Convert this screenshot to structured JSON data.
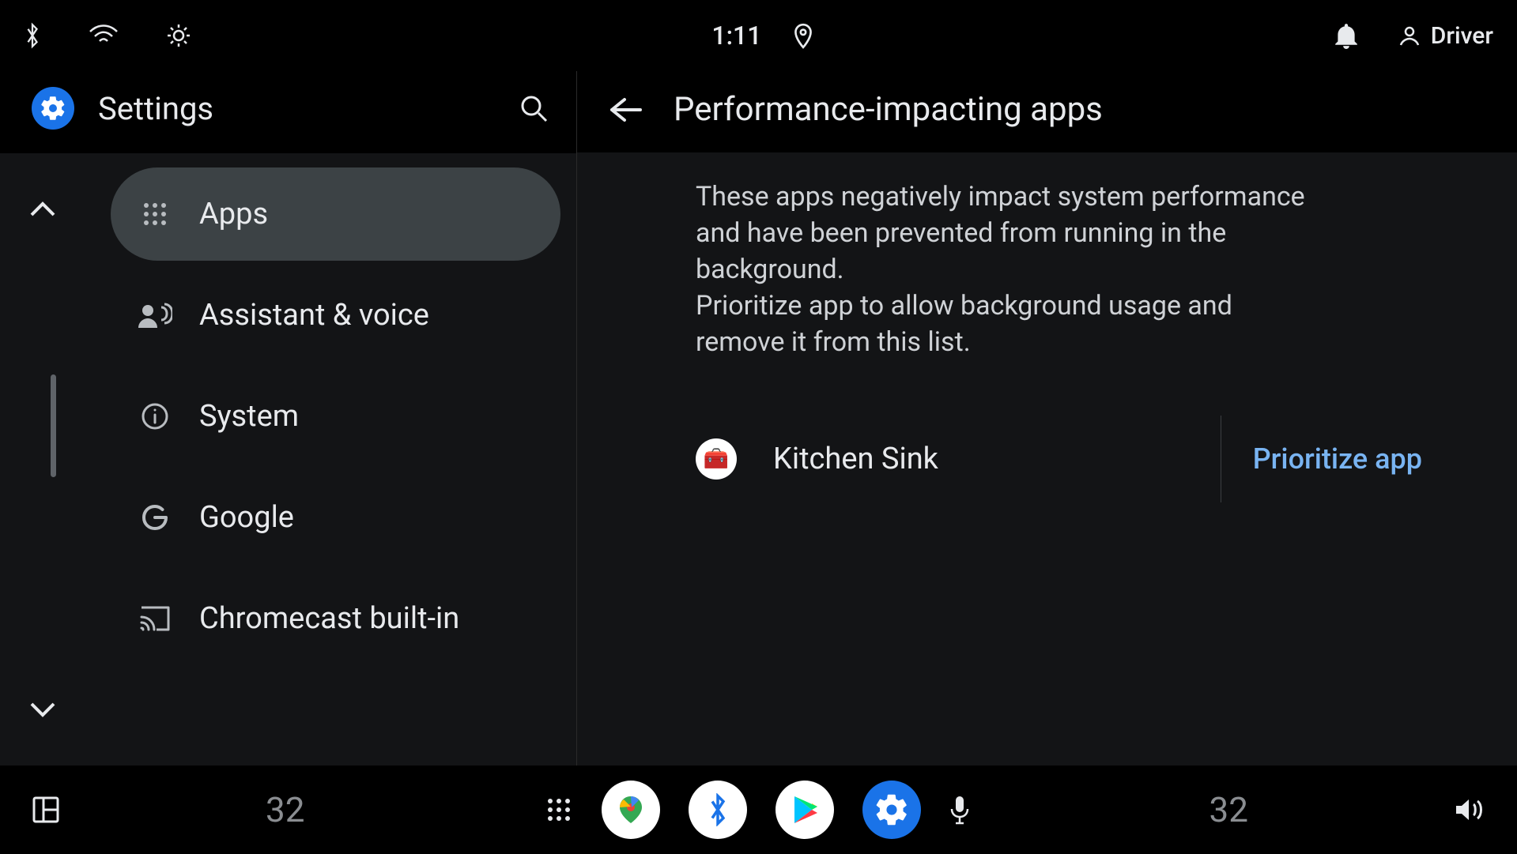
{
  "statusbar": {
    "time": "1:11",
    "profile_label": "Driver"
  },
  "sidebar": {
    "title": "Settings",
    "items": [
      {
        "label": "Apps",
        "icon": "apps-grid",
        "active": true
      },
      {
        "label": "Assistant & voice",
        "icon": "assistant",
        "active": false
      },
      {
        "label": "System",
        "icon": "info",
        "active": false
      },
      {
        "label": "Google",
        "icon": "google-g",
        "active": false
      },
      {
        "label": "Chromecast built-in",
        "icon": "cast",
        "active": false
      }
    ]
  },
  "content": {
    "title": "Performance-impacting apps",
    "description": "These apps negatively impact system performance and have been prevented from running in the background.\nPrioritize app to allow background usage and remove it from this list.",
    "apps": [
      {
        "name": "Kitchen Sink",
        "action_label": "Prioritize app"
      }
    ]
  },
  "dock": {
    "temp_left": "32",
    "temp_right": "32"
  },
  "colors": {
    "accent": "#1a73e8",
    "link": "#79b4f2",
    "bg_panel": "#131416",
    "sidebar_active": "#3c4245"
  }
}
